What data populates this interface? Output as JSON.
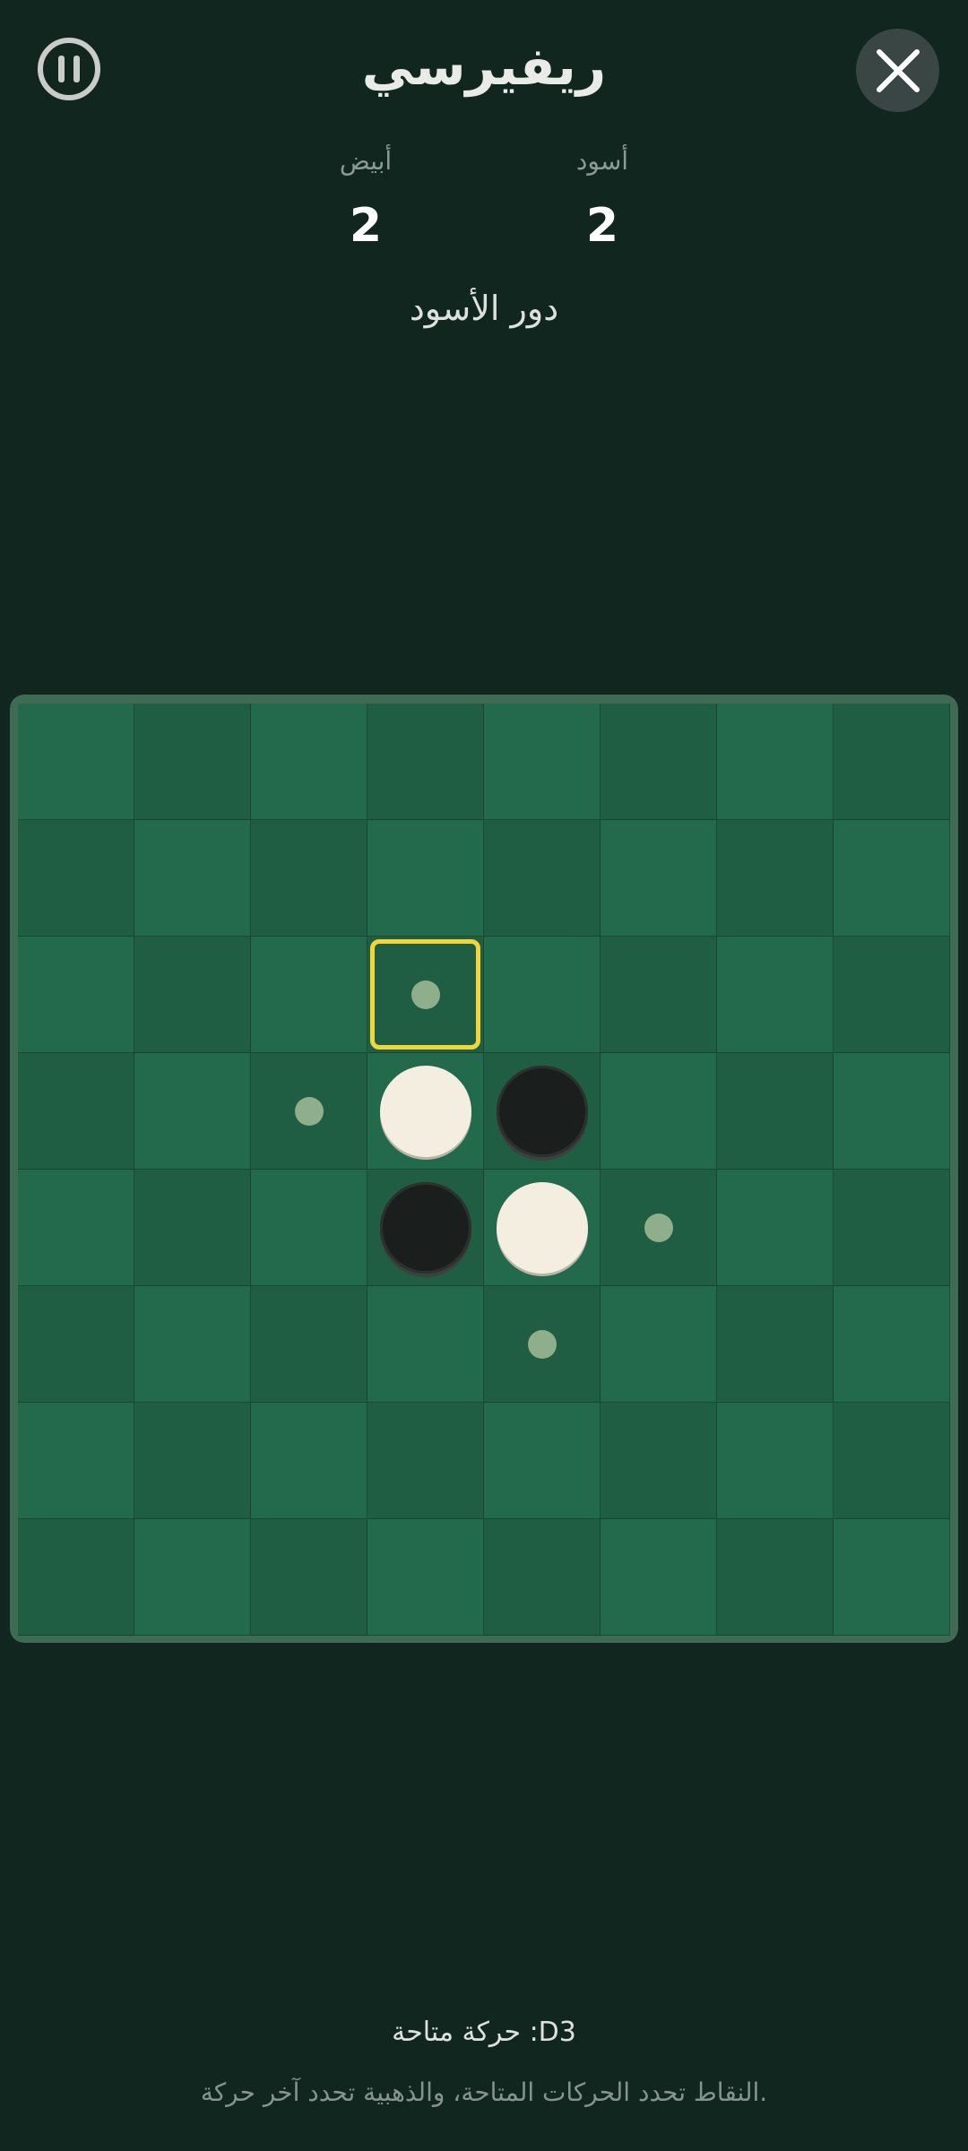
{
  "header": {
    "title": "ريفيرسي"
  },
  "scores": {
    "white": {
      "label": "أبيض",
      "value": "2"
    },
    "black": {
      "label": "أسود",
      "value": "2"
    }
  },
  "turn_text": "دور الأسود",
  "board": {
    "size": 8,
    "pieces": [
      {
        "row": 3,
        "col": 3,
        "color": "white"
      },
      {
        "row": 3,
        "col": 4,
        "color": "black"
      },
      {
        "row": 4,
        "col": 3,
        "color": "black"
      },
      {
        "row": 4,
        "col": 4,
        "color": "white"
      }
    ],
    "hints": [
      {
        "row": 2,
        "col": 3
      },
      {
        "row": 3,
        "col": 2
      },
      {
        "row": 4,
        "col": 5
      },
      {
        "row": 5,
        "col": 4
      }
    ],
    "highlight": {
      "row": 2,
      "col": 3
    },
    "colors": {
      "light_cell": "#236a4d",
      "dark_cell": "#1f5e43",
      "highlight": "#f0d63a",
      "hint": "#8fae8c"
    }
  },
  "footer": {
    "available_move": "حركة متاحة :D3",
    "hint_text": "النقاط تحدد الحركات المتاحة، والذهبية تحدد آخر حركة."
  },
  "icons": {
    "pause": "pause-icon",
    "close": "close-icon"
  }
}
